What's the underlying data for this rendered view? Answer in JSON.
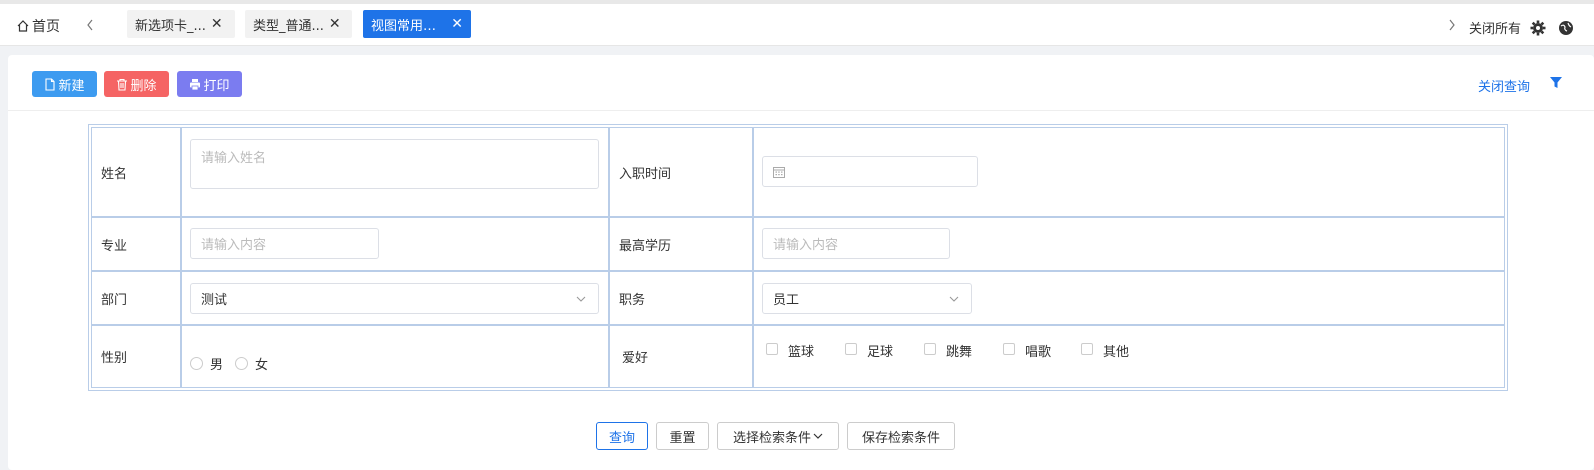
{
  "tabbar": {
    "home_label": "首页",
    "tabs": [
      {
        "label": "新选项卡_...",
        "close": "✕"
      },
      {
        "label": "类型_普通...",
        "close": "✕"
      },
      {
        "label": "视图常用查询",
        "close": "✕"
      }
    ],
    "close_all": "关闭所有",
    "active_color": "#1e73e8"
  },
  "toolbar": {
    "new_label": "新建",
    "delete_label": "删除",
    "print_label": "打印",
    "close_query": "关闭查询"
  },
  "form": {
    "name_label": "姓名",
    "name_placeholder": "请输入姓名",
    "hire_date_label": "入职时间",
    "major_label": "专业",
    "major_placeholder": "请输入内容",
    "education_label": "最高学历",
    "education_placeholder": "请输入内容",
    "dept_label": "部门",
    "dept_value": "测试",
    "position_label": "职务",
    "position_value": "员工",
    "gender_label": "性别",
    "gender_options": [
      "男",
      "女"
    ],
    "hobby_label": "爱好",
    "hobby_options": [
      "篮球",
      "足球",
      "跳舞",
      "唱歌",
      "其他"
    ]
  },
  "actions": {
    "query": "查询",
    "reset": "重置",
    "select_conditions": "选择检索条件",
    "save_conditions": "保存检索条件"
  }
}
